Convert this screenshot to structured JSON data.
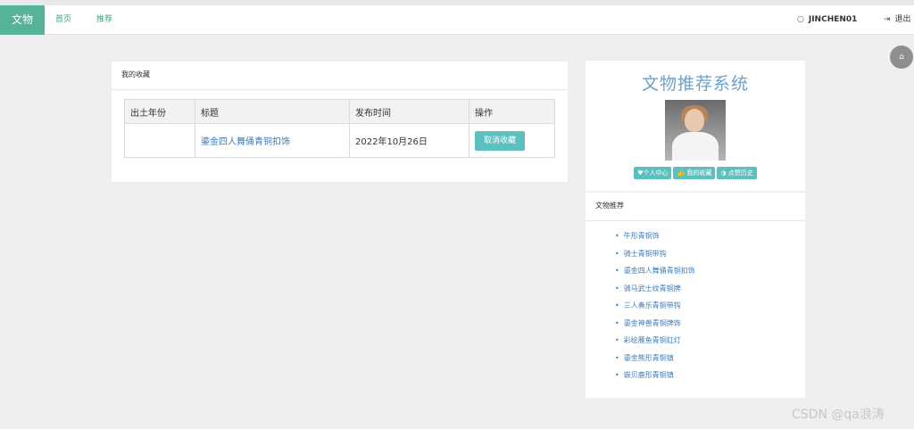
{
  "nav": {
    "brand": "文物",
    "links": [
      "首页",
      "推荐"
    ],
    "user": "JINCHEN01",
    "user_icon": "user-circle-icon",
    "logout": "退出",
    "logout_icon": "sign-out-icon",
    "home_icon": "home-icon"
  },
  "favorites": {
    "header": "我的收藏",
    "columns": [
      "出土年份",
      "标题",
      "发布时间",
      "操作"
    ],
    "rows": [
      {
        "year": "",
        "title": "鎏金四人舞俑青铜扣饰",
        "date": "2022年10月26日",
        "action": "取消收藏"
      }
    ]
  },
  "profile": {
    "site_title": "文物推荐系统",
    "tags": [
      {
        "icon": "heart-icon",
        "label": "个人中心"
      },
      {
        "icon": "thumbs-up-icon",
        "label": "我的收藏"
      },
      {
        "icon": "half-circle-icon",
        "label": "点赞历史"
      }
    ]
  },
  "recommend": {
    "header": "文物推荐",
    "items": [
      "牛形青铜饰",
      "骑士青铜带钩",
      "鎏金四人舞俑青铜扣饰",
      "骑马武士纹青铜牌",
      "三人奏乐青铜带钩",
      "鎏金神兽青铜牌饰",
      "彩绘雁鱼青铜釭灯",
      "鎏金熊形青铜镇",
      "嵌贝鹿形青铜镇"
    ]
  },
  "watermark": "CSDN @qa浪涛",
  "colors": {
    "brand": "#55b398",
    "accent": "#5bc0be",
    "link": "#3d7cb8"
  }
}
